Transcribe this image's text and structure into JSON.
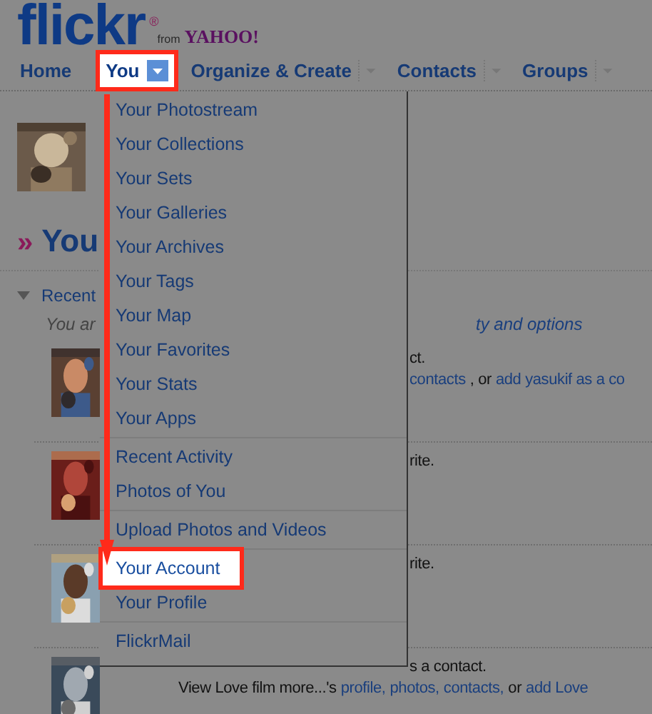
{
  "logo": {
    "wordmark": "flickr",
    "registered": "®",
    "from": "from",
    "partner": "YAHOO!"
  },
  "nav": [
    {
      "label": "Home",
      "dropdown": false,
      "selected": false
    },
    {
      "label": "You",
      "dropdown": true,
      "selected": true
    },
    {
      "label": "Organize & Create",
      "dropdown": true,
      "selected": false
    },
    {
      "label": "Contacts",
      "dropdown": true,
      "selected": false
    },
    {
      "label": "Groups",
      "dropdown": true,
      "selected": false
    }
  ],
  "menu": {
    "sections": [
      [
        {
          "label": "Your Photostream",
          "selected": false
        },
        {
          "label": "Your Collections",
          "selected": false
        },
        {
          "label": "Your Sets",
          "selected": false
        },
        {
          "label": "Your Galleries",
          "selected": false
        },
        {
          "label": "Your Archives",
          "selected": false
        },
        {
          "label": "Your Tags",
          "selected": false
        },
        {
          "label": "Your Map",
          "selected": false
        },
        {
          "label": "Your Favorites",
          "selected": false
        },
        {
          "label": "Your Stats",
          "selected": false
        },
        {
          "label": "Your Apps",
          "selected": false
        }
      ],
      [
        {
          "label": "Recent Activity",
          "selected": false
        },
        {
          "label": "Photos of You",
          "selected": false
        }
      ],
      [
        {
          "label": "Upload Photos and Videos",
          "selected": false
        }
      ],
      [
        {
          "label": "Your Account",
          "selected": true
        },
        {
          "label": "Your Profile",
          "selected": false
        }
      ],
      [
        {
          "label": "FlickrMail",
          "selected": false
        }
      ]
    ]
  },
  "heading": {
    "mark": "»",
    "text": "You"
  },
  "activity": {
    "title": "Recent",
    "note": "You ar",
    "link": "ty and options"
  },
  "feed": [
    {
      "first": [
        {
          "text": "ct.",
          "link": false
        }
      ],
      "second": [
        {
          "text": "contacts",
          "link": true
        },
        {
          "text": ", or",
          "link": false
        },
        {
          "text": "add yasukif as a co",
          "link": true
        }
      ]
    },
    {
      "first": [
        {
          "text": "rite.",
          "link": false
        }
      ]
    },
    {
      "first": [
        {
          "text": "rite.",
          "link": false
        }
      ]
    },
    {
      "first": [
        {
          "text": "s a contact.",
          "link": false
        }
      ],
      "second": [
        {
          "text": "View Love film more...'s",
          "link": false
        },
        {
          "text": "profile,",
          "link": true
        },
        {
          "text": "photos,",
          "link": true
        },
        {
          "text": "contacts,",
          "link": true
        },
        {
          "text": "or",
          "link": false
        },
        {
          "text": "add Love",
          "link": true
        }
      ]
    }
  ]
}
